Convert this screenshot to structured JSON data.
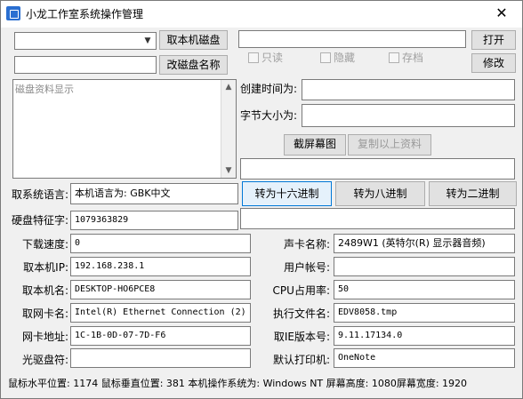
{
  "window": {
    "title": "小龙工作室系统操作管理",
    "close_glyph": "✕"
  },
  "left": {
    "drive_combo_value": "",
    "drive_name_value": "",
    "get_disk_button": "取本机磁盘",
    "rename_disk_button": "改磁盘名称",
    "disk_info_placeholder": "磁盘资料显示"
  },
  "right": {
    "file_path_value": "",
    "open_button": "打开",
    "readonly_label": "只读",
    "hidden_label": "隐藏",
    "archive_label": "存档",
    "modify_button": "修改",
    "created_label": "创建时间为:",
    "created_value": "",
    "size_label": "字节大小为:",
    "size_value": "",
    "screenshot_button": "截屏幕图",
    "copy_button": "复制以上资料",
    "convert_input_value": "",
    "hex_button": "转为十六进制",
    "oct_button": "转为八进制",
    "bin_button": "转为二进制",
    "convert_output_value": ""
  },
  "fields": {
    "lang_label": "取系统语言:",
    "lang_value": "本机语言为: GBK中文",
    "hdd_label": "硬盘特征字:",
    "hdd_value": "1079363829",
    "download_label": "下载速度:",
    "download_value": "0",
    "ip_label": "取本机IP:",
    "ip_value": "192.168.238.1",
    "hostname_label": "取本机名:",
    "hostname_value": "DESKTOP-HO6PCE8",
    "nic_name_label": "取网卡名:",
    "nic_name_value": "Intel(R) Ethernet Connection (2)",
    "mac_label": "网卡地址:",
    "mac_value": "1C-1B-0D-07-7D-F6",
    "cd_label": "光驱盘符:",
    "cd_value": "",
    "sound_label": "声卡名称:",
    "sound_value": "2489W1 (英特尔(R) 显示器音频)",
    "user_label": "用户帐号:",
    "user_value": "",
    "cpu_label": "CPU占用率:",
    "cpu_value": "50",
    "exe_label": "执行文件名:",
    "exe_value": "EDV8058.tmp",
    "ie_label": "取IE版本号:",
    "ie_value": "9.11.17134.0",
    "printer_label": "默认打印机:",
    "printer_value": "OneNote"
  },
  "status": {
    "text": "鼠标水平位置: 1174  鼠标垂直位置: 381 本机操作系统为:  Windows NT  屏幕高度: 1080屏幕宽度: 1920"
  }
}
